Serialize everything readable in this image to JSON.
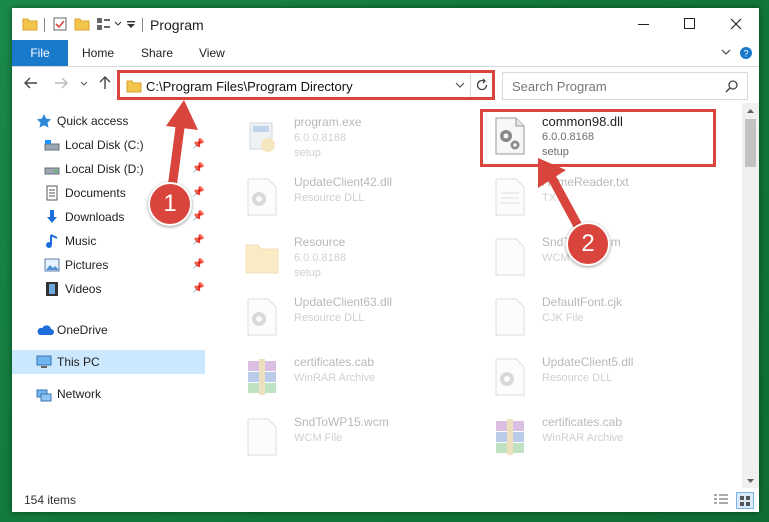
{
  "window": {
    "title": "Program"
  },
  "ribbon": {
    "tabs": [
      "File",
      "Home",
      "Share",
      "View"
    ]
  },
  "address": {
    "path": "C:\\Program Files\\Program Directory"
  },
  "search": {
    "placeholder": "Search Program"
  },
  "sidebar": {
    "items": [
      {
        "label": "Quick access",
        "icon": "star-icon"
      },
      {
        "label": "Local Disk (C:)",
        "icon": "drive-icon",
        "pinned": true
      },
      {
        "label": "Local Disk (D:)",
        "icon": "drive-icon",
        "pinned": true
      },
      {
        "label": "Documents",
        "icon": "documents-icon",
        "pinned": true
      },
      {
        "label": "Downloads",
        "icon": "download-icon",
        "pinned": true
      },
      {
        "label": "Music",
        "icon": "music-icon",
        "pinned": true
      },
      {
        "label": "Pictures",
        "icon": "pictures-icon",
        "pinned": true
      },
      {
        "label": "Videos",
        "icon": "videos-icon",
        "pinned": true
      },
      {
        "label": "OneDrive",
        "icon": "cloud-icon"
      },
      {
        "label": "This PC",
        "icon": "computer-icon",
        "selected": true
      },
      {
        "label": "Network",
        "icon": "network-icon"
      }
    ]
  },
  "files": [
    {
      "name": "program.exe",
      "meta1": "6.0.0.8168",
      "meta2": "setup",
      "icon": "exe-icon"
    },
    {
      "name": "common98.dll",
      "meta1": "6.0.0.8168",
      "meta2": "setup",
      "icon": "dll-gear-icon",
      "highlighted": true
    },
    {
      "name": "UpdateClient42.dll",
      "meta1": "Resource DLL",
      "meta2": "",
      "icon": "dll-gear-icon"
    },
    {
      "name": "HomeReader.txt",
      "meta1": "TXT",
      "meta2": "",
      "icon": "text-file-icon"
    },
    {
      "name": "Resource",
      "meta1": "6.0.0.8168",
      "meta2": "setup",
      "icon": "folder-icon"
    },
    {
      "name": "SndToMe.wcm",
      "meta1": "WCM File",
      "meta2": "",
      "icon": "blank-file-icon"
    },
    {
      "name": "UpdateClient63.dll",
      "meta1": "Resource DLL",
      "meta2": "",
      "icon": "dll-gear-icon"
    },
    {
      "name": "DefaultFont.cjk",
      "meta1": "CJK File",
      "meta2": "",
      "icon": "blank-file-icon"
    },
    {
      "name": "certificates.cab",
      "meta1": "WinRAR Archive",
      "meta2": "",
      "icon": "winrar-icon"
    },
    {
      "name": "UpdateClient5.dll",
      "meta1": "Resource DLL",
      "meta2": "",
      "icon": "dll-gear-icon"
    },
    {
      "name": "SndToWP15.wcm",
      "meta1": "WCM File",
      "meta2": "",
      "icon": "blank-file-icon"
    },
    {
      "name": "certificates.cab",
      "meta1": "WinRAR Archive",
      "meta2": "",
      "icon": "winrar-icon"
    }
  ],
  "status": {
    "count": "154 items"
  },
  "annotations": {
    "step1": "1",
    "step2": "2"
  },
  "colors": {
    "accent": "#1979ca",
    "annotation": "#d9453d",
    "selection": "#cce8ff"
  }
}
